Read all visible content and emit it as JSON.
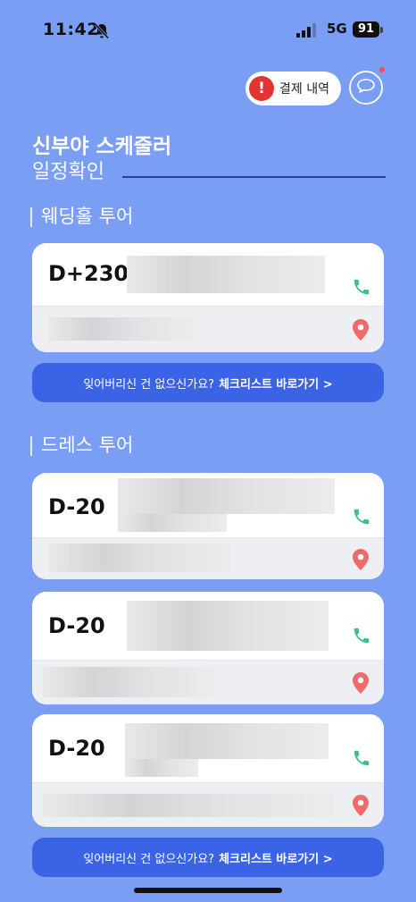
{
  "status_bar": {
    "time": "11:42",
    "network": "5G",
    "battery": "91"
  },
  "header": {
    "payment_button": {
      "icon": "!",
      "label": "결제 내역"
    },
    "chat_icon": "chat-bubble-icon"
  },
  "title": {
    "app_name": "신부야 스케줄러",
    "subtitle": "일정확인"
  },
  "sections": [
    {
      "title": "웨딩홀 투어",
      "cards": [
        {
          "d_day": "D+230"
        }
      ]
    },
    {
      "title": "드레스 투어",
      "cards": [
        {
          "d_day": "D-20"
        },
        {
          "d_day": "D-20"
        },
        {
          "d_day": "D-20"
        }
      ]
    }
  ],
  "checklist": {
    "question": "잊어버리신 건 없으신가요?",
    "link": "체크리스트 바로가기 >"
  },
  "colors": {
    "background": "#7b9ef5",
    "button": "#3a63e6",
    "phone": "#3fbf8f",
    "pin": "#ef6b6b"
  }
}
